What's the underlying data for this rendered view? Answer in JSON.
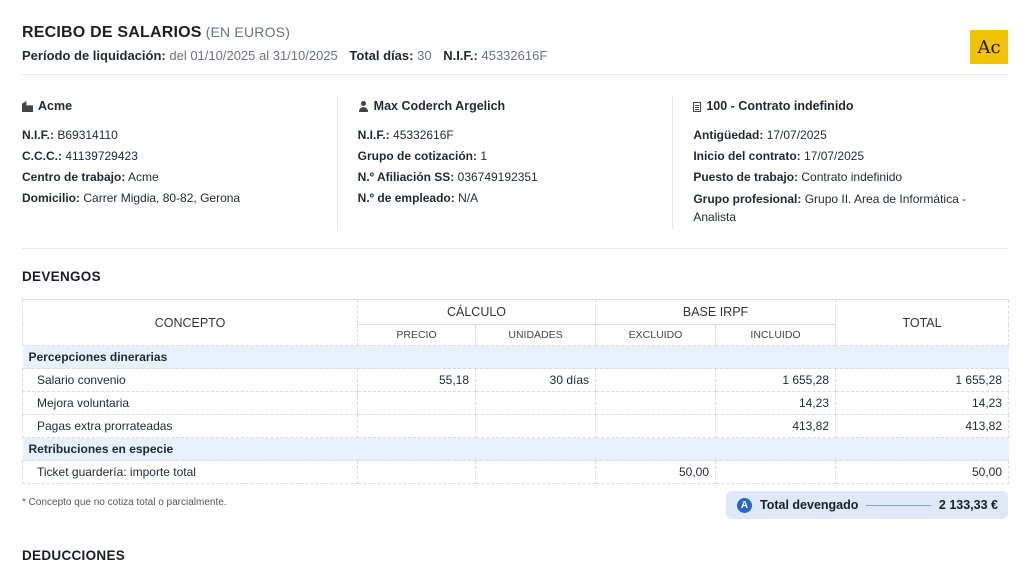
{
  "header": {
    "title": "RECIBO DE SALARIOS",
    "title_sub": "(EN EUROS)",
    "period_label": "Período de liquidación:",
    "period_value": "del 01/10/2025 al 31/10/2025",
    "days_label": "Total días:",
    "days_value": "30",
    "nif_label": "N.I.F.:",
    "nif_value": "45332616F",
    "logo_text": "Ac"
  },
  "company": {
    "icon": "building-icon",
    "name": "Acme",
    "rows": [
      {
        "k": "N.I.F.:",
        "v": "B69314110"
      },
      {
        "k": "C.C.C.:",
        "v": "41139729423"
      },
      {
        "k": "Centro de trabajo:",
        "v": "Acme"
      },
      {
        "k": "Domicilio:",
        "v": "Carrer Migdia, 80-82, Gerona"
      }
    ]
  },
  "employee": {
    "icon": "user-icon",
    "name": "Max Coderch Argelich",
    "rows": [
      {
        "k": "N.I.F.:",
        "v": "45332616F"
      },
      {
        "k": "Grupo de cotización:",
        "v": "1"
      },
      {
        "k": "N.º Afiliación SS:",
        "v": "036749192351"
      },
      {
        "k": "N.º de empleado:",
        "v": "N/A"
      }
    ]
  },
  "contract": {
    "icon": "document-icon",
    "name": "100 - Contrato indefinido",
    "rows": [
      {
        "k": "Antigüedad:",
        "v": "17/07/2025"
      },
      {
        "k": "Inicio del contrato:",
        "v": "17/07/2025"
      },
      {
        "k": "Puesto de trabajo:",
        "v": "Contrato indefinido"
      },
      {
        "k": "Grupo profesional:",
        "v": "Grupo II. Area de Informática - Analista"
      }
    ]
  },
  "devengos": {
    "title": "DEVENGOS",
    "headers": {
      "concepto": "CONCEPTO",
      "calculo": "CÁLCULO",
      "base_irpf": "BASE IRPF",
      "total": "TOTAL",
      "precio": "PRECIO",
      "unidades": "UNIDADES",
      "excluido": "EXCLUIDO",
      "incluido": "INCLUIDO"
    },
    "groups": [
      {
        "name": "Percepciones dinerarias",
        "rows": [
          {
            "concepto": "Salario convenio",
            "precio": "55,18",
            "unidades": "30 días",
            "excluido": "",
            "incluido": "1 655,28",
            "total": "1 655,28"
          },
          {
            "concepto": "Mejora voluntaria",
            "precio": "",
            "unidades": "",
            "excluido": "",
            "incluido": "14,23",
            "total": "14,23"
          },
          {
            "concepto": "Pagas extra prorrateadas",
            "precio": "",
            "unidades": "",
            "excluido": "",
            "incluido": "413,82",
            "total": "413,82"
          }
        ]
      },
      {
        "name": "Retribuciones en especie",
        "rows": [
          {
            "concepto": "Ticket guardería: importe total",
            "precio": "",
            "unidades": "",
            "excluido": "50,00",
            "incluido": "",
            "total": "50,00"
          }
        ]
      }
    ],
    "note": "* Concepto que no cotiza total o parcialmente.",
    "total_badge": "A",
    "total_label": "Total devengado",
    "total_value": "2 133,33 €"
  },
  "deducciones": {
    "title": "DEDUCCIONES"
  }
}
